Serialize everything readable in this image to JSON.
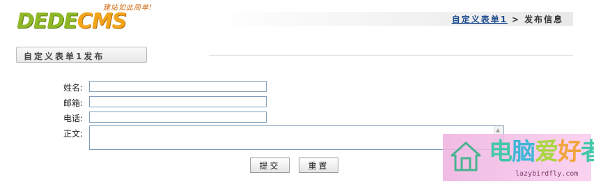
{
  "header": {
    "logo_text_1": "DEDE",
    "logo_text_2": "CMS",
    "logo_tagline": "建站如此简单!",
    "breadcrumb": {
      "link": "自定义表单1",
      "separator": ">",
      "current": "发布信息"
    }
  },
  "section_tab": {
    "label": "自定义表单1发布"
  },
  "form": {
    "fields": [
      {
        "label": "姓名:",
        "value": ""
      },
      {
        "label": "邮箱:",
        "value": ""
      },
      {
        "label": "电话:",
        "value": ""
      },
      {
        "label": "正文:",
        "value": ""
      }
    ],
    "submit_label": "提交",
    "reset_label": "重置"
  },
  "watermark": {
    "char_1": "电",
    "char_2": "脑",
    "char_3": "爱",
    "char_4": "好",
    "char_5": "者",
    "url": "lazybirdfly.com"
  },
  "colors": {
    "logo_green": "#8fb826",
    "logo_orange": "#f2a51b",
    "link_blue": "#1d4b8f",
    "input_border": "#7f9db9"
  }
}
